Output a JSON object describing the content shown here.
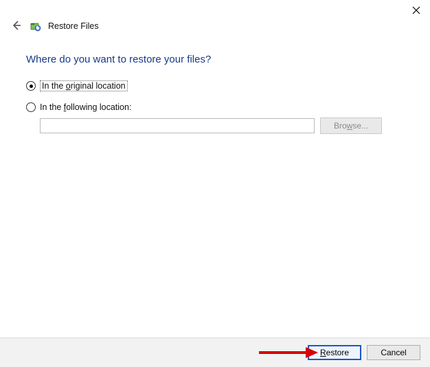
{
  "window": {
    "title": "Restore Files"
  },
  "headline": "Where do you want to restore your files?",
  "options": {
    "original": {
      "pre": "In the ",
      "ukey": "o",
      "post": "riginal location"
    },
    "following": {
      "pre": "In the ",
      "ukey": "f",
      "post": "ollowing location:"
    },
    "path_value": "",
    "browse_pre": "Bro",
    "browse_ukey": "w",
    "browse_post": "se..."
  },
  "footer": {
    "restore_ukey": "R",
    "restore_post": "estore",
    "cancel": "Cancel"
  }
}
